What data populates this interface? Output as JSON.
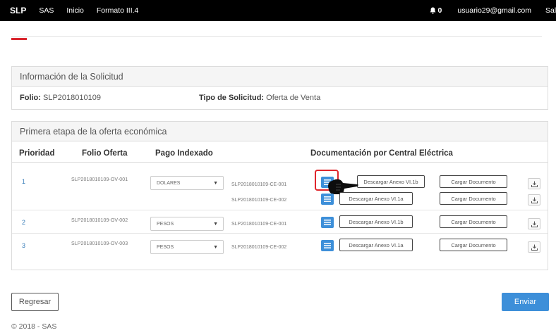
{
  "navbar": {
    "brand": "SLP",
    "links": [
      "SAS",
      "Inicio",
      "Formato III.4"
    ],
    "notification_count": "0",
    "email": "usuario29@gmail.com",
    "logout": "Salir"
  },
  "info_panel": {
    "title": "Información de la Solicitud",
    "folio_label": "Folio:",
    "folio_value": "SLP2018010109",
    "tipo_label": "Tipo de Solicitud:",
    "tipo_value": "Oferta de Venta"
  },
  "offer_panel": {
    "title": "Primera etapa de la oferta económica",
    "headers": {
      "prioridad": "Prioridad",
      "folio_oferta": "Folio Oferta",
      "pago_indexado": "Pago Indexado",
      "documentacion": "Documentación por Central Eléctrica"
    },
    "rows": [
      {
        "prioridad": "1",
        "folio": "SLP2018010109-OV-001",
        "pago": "DOLARES",
        "centrales": [
          {
            "central": "SLP2018010109-CE-001",
            "descargar": "Descargar Anexo VI.1b",
            "cargar": "Cargar Documento"
          },
          {
            "central": "SLP2018010109-CE-002",
            "descargar": "Descargar Anexo VI.1a",
            "cargar": "Cargar Documento"
          }
        ]
      },
      {
        "prioridad": "2",
        "folio": "SLP2018010109-OV-002",
        "pago": "PESOS",
        "centrales": [
          {
            "central": "SLP2018010109-CE-001",
            "descargar": "Descargar Anexo VI.1b",
            "cargar": "Cargar Documento"
          }
        ]
      },
      {
        "prioridad": "3",
        "folio": "SLP2018010109-OV-003",
        "pago": "PESOS",
        "centrales": [
          {
            "central": "SLP2018010109-CE-002",
            "descargar": "Descargar Anexo VI.1a",
            "cargar": "Cargar Documento"
          }
        ]
      }
    ]
  },
  "actions": {
    "back": "Regresar",
    "send": "Enviar"
  },
  "footer": "© 2018 - SAS",
  "colors": {
    "navbar_bg": "#000000",
    "accent_blue": "#3d8fd9",
    "highlight_red": "#e0262c"
  }
}
